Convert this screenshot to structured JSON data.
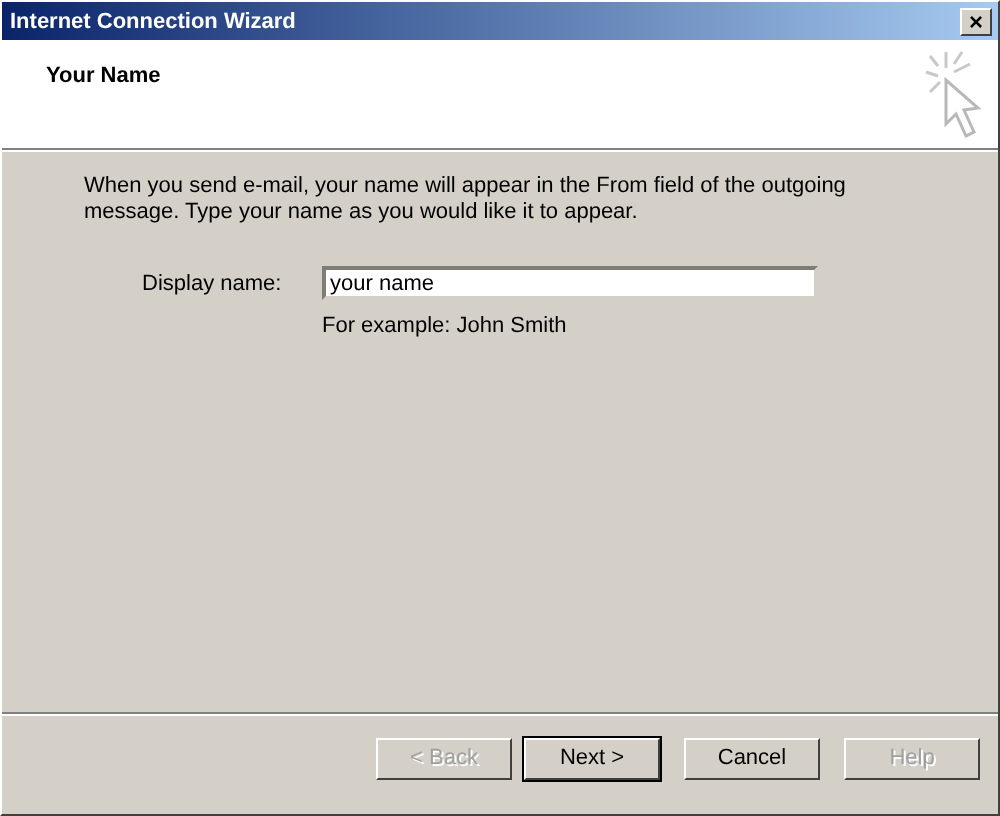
{
  "window": {
    "title": "Internet Connection Wizard",
    "close": "×"
  },
  "header": {
    "title": "Your Name"
  },
  "intro": "When you send e-mail, your name will appear in the From field of the outgoing message. Type your name as you would like it to appear.",
  "display_name": {
    "label": "Display name:",
    "value": "your name",
    "hint": "For example: John Smith"
  },
  "buttons": [
    {
      "label": "< Back",
      "disabled": true,
      "default": false
    },
    {
      "label": "Next >",
      "disabled": false,
      "default": true
    },
    {
      "label": "Cancel",
      "disabled": false,
      "default": false
    },
    {
      "label": "Help",
      "disabled": true,
      "default": false
    }
  ]
}
